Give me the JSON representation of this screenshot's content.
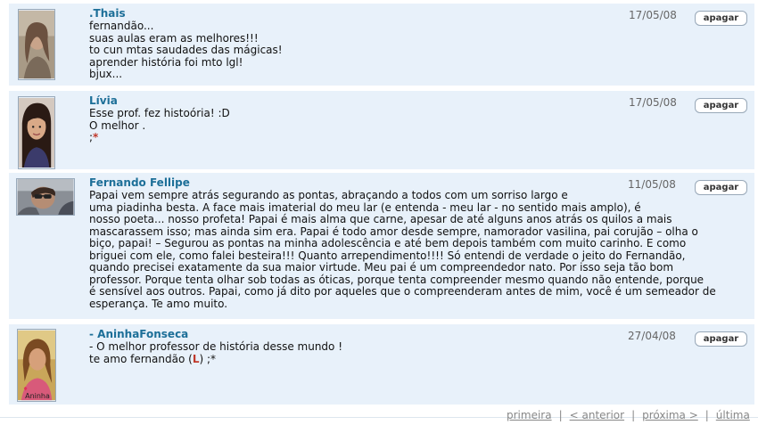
{
  "scraps": [
    {
      "author": ".Thais",
      "date": "17/05/08",
      "delete_label": "apagar",
      "message": "fernandão...\nsuas aulas eram as melhores!!!\nto cun mtas saudades das mágicas!\naprender história foi mto lgl!\nbjux..."
    },
    {
      "author": "Lívia",
      "date": "17/05/08",
      "delete_label": "apagar",
      "message_main": "Esse prof. fez histoória! :D\nO melhor .\n;",
      "message_heart": "*"
    },
    {
      "author": "Fernando Fellipe",
      "date": "11/05/08",
      "delete_label": "apagar",
      "message": "Papai vem sempre atrás segurando as pontas, abraçando a todos com um sorriso largo e\numa piadinha besta. A face mais imaterial do meu lar (e entenda - meu lar - no sentido mais amplo), é\nnosso poeta... nosso profeta! Papai é mais alma que carne, apesar de até alguns anos atrás os quilos a mais\nmascarassem isso; mas ainda sim era. Papai é todo amor desde sempre, namorador vasilina, pai corujão – olha o\nbiço, papai! – Segurou as pontas na minha adolescência e até bem depois também com muito carinho. E como\nbriguei com ele, como falei besteira!!! Quanto arrependimento!!!! Só entendi de verdade o jeito do Fernandão,\nquando precisei exatamente da sua maior virtude. Meu pai é um compreendedor nato. Por isso seja tão bom\nprofessor. Porque tenta olhar sob todas as óticas, porque tenta compreender mesmo quando não entende, porque\né sensível aos outros. Papai, como já dito por aqueles que o compreenderam antes de mim, você é um semeador de\nesperança. Te amo muito."
    },
    {
      "author": "- AninhaFonseca",
      "date": "27/04/08",
      "delete_label": "apagar",
      "message_line1": "- O melhor professor de história desse mundo !",
      "message_line2_pre": "te amo fernandão (",
      "message_line2_l": "L",
      "message_line2_post": ") ;*",
      "avatar_caption": "Aninha"
    }
  ],
  "pagination": {
    "first": "primeira",
    "prev": "< anterior",
    "next": "próxima >",
    "last": "última",
    "separator": "|"
  },
  "colors": {
    "row_background": "#e8f1fa",
    "author": "#1d6f98",
    "heart": "#c0392b"
  }
}
